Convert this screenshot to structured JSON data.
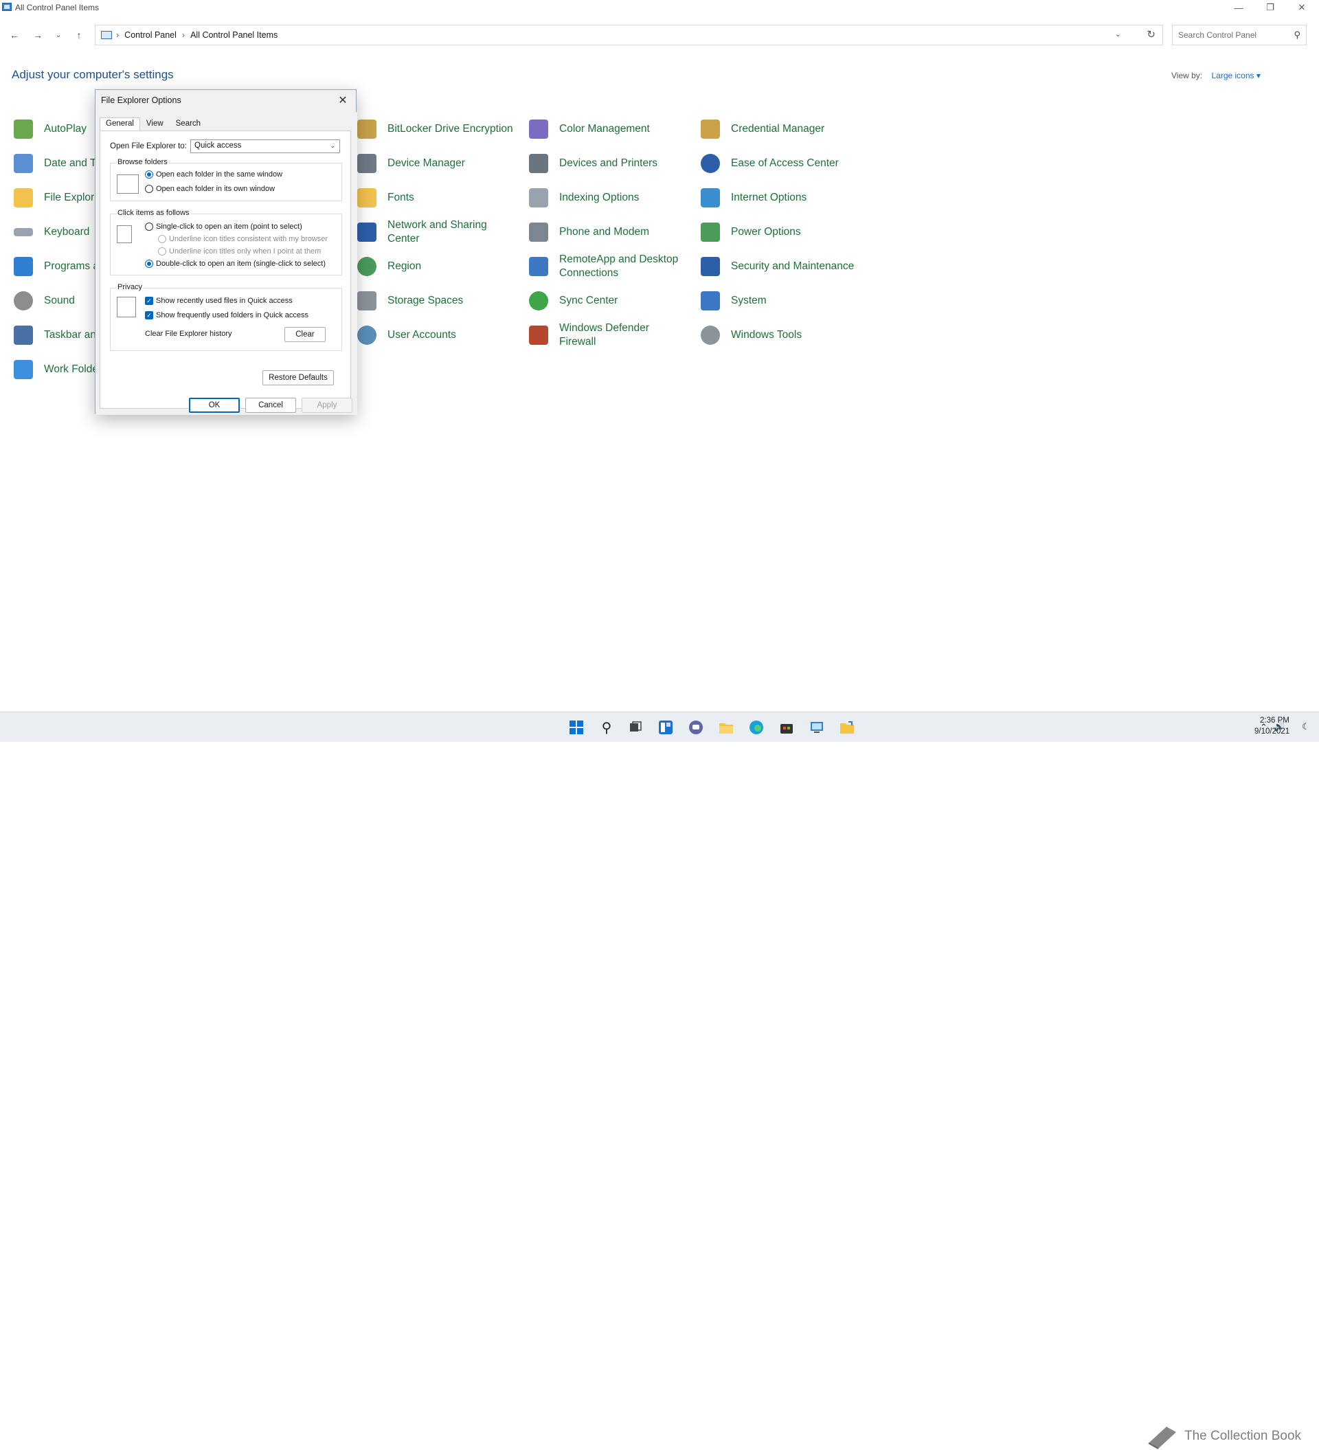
{
  "window": {
    "title": "All Control Panel Items"
  },
  "address": {
    "crumbs": [
      "Control Panel",
      "All Control Panel Items"
    ],
    "search_placeholder": "Search Control Panel"
  },
  "header": {
    "heading": "Adjust your computer's settings",
    "view_by_label": "View by:",
    "view_by_value": "Large icons"
  },
  "items": {
    "col1": [
      "AutoPlay",
      "Date and Ti",
      "File Explore",
      "Keyboard",
      "Programs a",
      "Sound",
      "Taskbar and",
      "Work Folde"
    ],
    "col2": [
      "BitLocker Drive Encryption",
      "Device Manager",
      "Fonts",
      "Network and Sharing Center",
      "Region",
      "Storage Spaces",
      "User Accounts"
    ],
    "col3": [
      "Color Management",
      "Devices and Printers",
      "Indexing Options",
      "Phone and Modem",
      "RemoteApp and Desktop Connections",
      "Sync Center",
      "Windows Defender Firewall"
    ],
    "col4": [
      "Credential Manager",
      "Ease of Access Center",
      "Internet Options",
      "Power Options",
      "Security and Maintenance",
      "System",
      "Windows Tools"
    ]
  },
  "dialog": {
    "title": "File Explorer Options",
    "tabs": [
      "General",
      "View",
      "Search"
    ],
    "open_to_label": "Open File Explorer to:",
    "open_to_value": "Quick access",
    "browse_group": "Browse folders",
    "browse_same": "Open each folder in the same window",
    "browse_own": "Open each folder in its own window",
    "click_group": "Click items as follows",
    "single_click": "Single-click to open an item (point to select)",
    "underline_browser": "Underline icon titles consistent with my browser",
    "underline_point": "Underline icon titles only when I point at them",
    "double_click": "Double-click to open an item (single-click to select)",
    "privacy_group": "Privacy",
    "recent_files": "Show recently used files in Quick access",
    "frequent_folders": "Show frequently used folders in Quick access",
    "clear_history_label": "Clear File Explorer history",
    "clear_button": "Clear",
    "restore_button": "Restore Defaults",
    "ok_button": "OK",
    "cancel_button": "Cancel",
    "apply_button": "Apply"
  },
  "taskbar": {
    "time": "2:36 PM",
    "date": "9/10/2021",
    "watermark": "The Collection Book"
  },
  "colors": {
    "link_green": "#1e6f3a",
    "accent": "#0067c0",
    "heading_blue": "#1e4f8f"
  }
}
